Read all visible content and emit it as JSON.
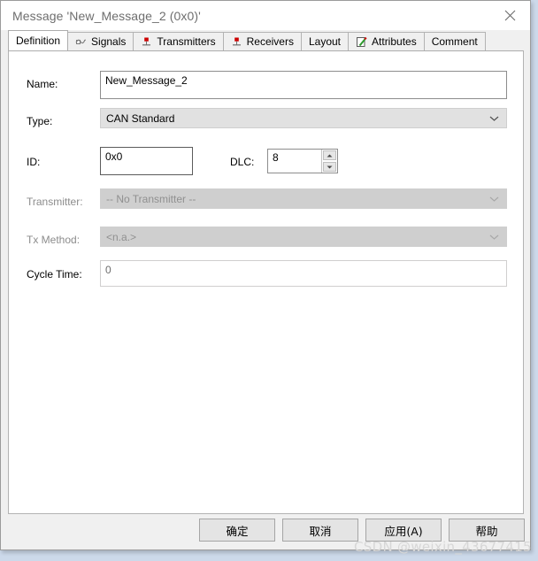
{
  "window": {
    "title": "Message 'New_Message_2 (0x0)'",
    "close_icon": "close-icon"
  },
  "tabs": [
    {
      "label": "Definition",
      "icon": "none",
      "active": true
    },
    {
      "label": "Signals",
      "icon": "signal-wave-icon",
      "active": false
    },
    {
      "label": "Transmitters",
      "icon": "node-pin-icon",
      "active": false
    },
    {
      "label": "Receivers",
      "icon": "node-pin-icon",
      "active": false
    },
    {
      "label": "Layout",
      "icon": "none",
      "active": false
    },
    {
      "label": "Attributes",
      "icon": "notepad-pen-icon",
      "active": false
    },
    {
      "label": "Comment",
      "icon": "none",
      "active": false
    }
  ],
  "form": {
    "name": {
      "label": "Name:",
      "value": "New_Message_2"
    },
    "type": {
      "label": "Type:",
      "value": "CAN Standard"
    },
    "id": {
      "label": "ID:",
      "value": "0x0"
    },
    "dlc": {
      "label": "DLC:",
      "value": "8"
    },
    "transmitter": {
      "label": "Transmitter:",
      "value": "-- No Transmitter --"
    },
    "tx_method": {
      "label": "Tx Method:",
      "value": "<n.a.>"
    },
    "cycle_time": {
      "label": "Cycle Time:",
      "value": "0"
    }
  },
  "footer": {
    "ok": "确定",
    "cancel": "取消",
    "apply": "应用(A)",
    "help": "帮助"
  },
  "watermark": "CSDN @weixin_43677415",
  "colors": {
    "window_bg": "#f0f0f0",
    "panel_bg": "#ffffff",
    "desktop_bg": "#ccd9ea",
    "disabled_fg": "#909090",
    "accent_red": "#cc0000",
    "accent_green": "#2c9a2c"
  }
}
